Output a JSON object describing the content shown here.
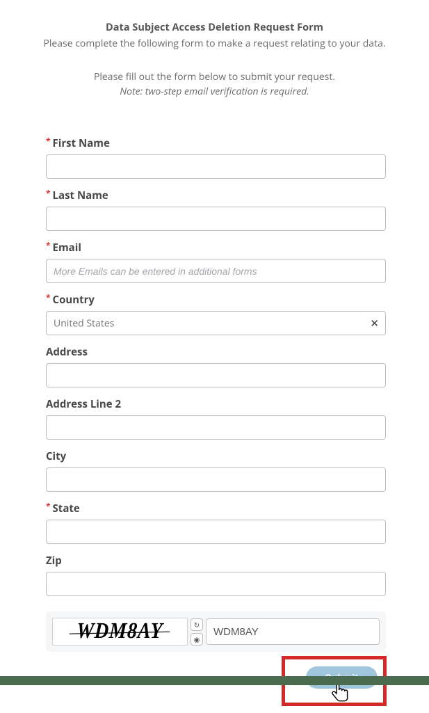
{
  "header": {
    "title": "Data Subject Access Deletion Request Form",
    "subtitle": "Please complete the following form to make a request relating to your data.",
    "instruction": "Please fill out the form below to submit your request.",
    "note": "Note: two-step email verification is required."
  },
  "fields": {
    "first_name": {
      "label": "First Name",
      "required": true,
      "value": ""
    },
    "last_name": {
      "label": "Last Name",
      "required": true,
      "value": ""
    },
    "email": {
      "label": "Email",
      "required": true,
      "value": "",
      "placeholder": "More Emails can be entered in additional forms"
    },
    "country": {
      "label": "Country",
      "required": true,
      "value": "United States"
    },
    "address": {
      "label": "Address",
      "required": false,
      "value": ""
    },
    "address2": {
      "label": "Address Line 2",
      "required": false,
      "value": ""
    },
    "city": {
      "label": "City",
      "required": false,
      "value": ""
    },
    "state": {
      "label": "State",
      "required": true,
      "value": ""
    },
    "zip": {
      "label": "Zip",
      "required": false,
      "value": ""
    }
  },
  "captcha": {
    "image_text": "WDM8AY",
    "input_value": "WDM8AY"
  },
  "submit": {
    "label": "Submit"
  },
  "required_marker": "*"
}
